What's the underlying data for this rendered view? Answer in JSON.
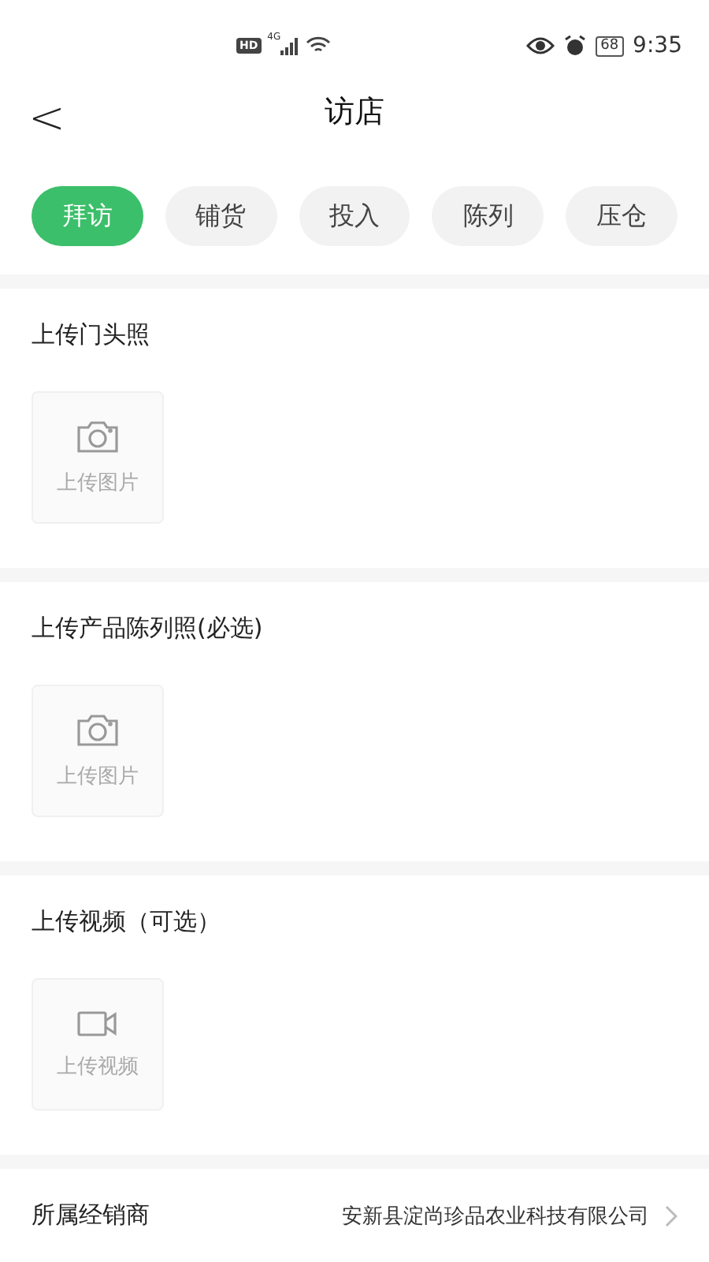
{
  "status_bar": {
    "hd": "HD",
    "network": "4G",
    "battery": "68",
    "time": "9:35"
  },
  "header": {
    "back": "<",
    "title": "访店"
  },
  "tabs": [
    {
      "label": "拜访",
      "selected": true
    },
    {
      "label": "铺货",
      "selected": false
    },
    {
      "label": "投入",
      "selected": false
    },
    {
      "label": "陈列",
      "selected": false
    },
    {
      "label": "压仓",
      "selected": false
    }
  ],
  "sections": [
    {
      "title": "上传门头照",
      "kind": "photo",
      "upload_label": "上传图片"
    },
    {
      "title": "上传产品陈列照(必选)",
      "kind": "photo",
      "upload_label": "上传图片"
    },
    {
      "title": "上传视频（可选）",
      "kind": "video",
      "upload_label": "上传视频"
    }
  ],
  "distributor": {
    "label": "所属经销商",
    "value": "安新县淀尚珍品农业科技有限公司"
  }
}
